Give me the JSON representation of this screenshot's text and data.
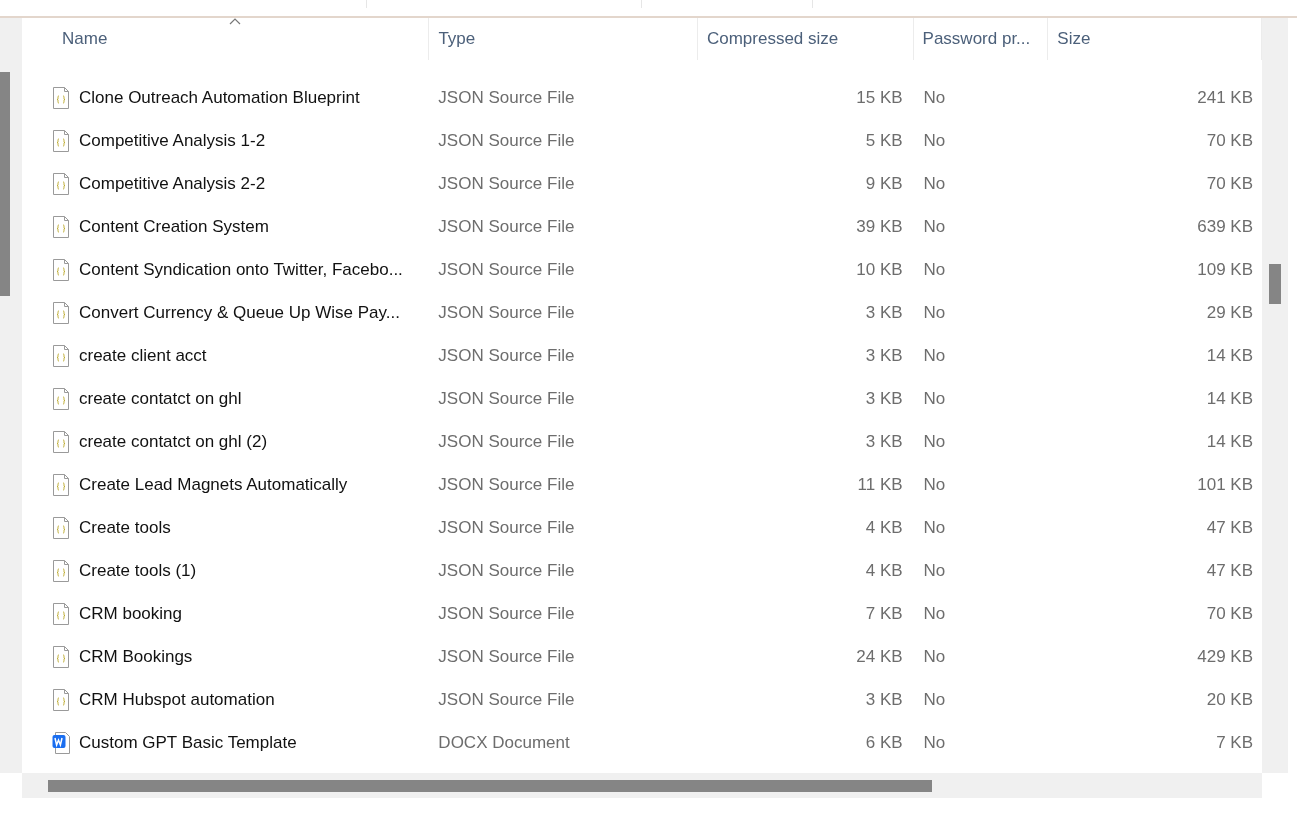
{
  "columns": [
    {
      "label": "Name",
      "sorted": true
    },
    {
      "label": "Type",
      "sorted": false
    },
    {
      "label": "Compressed size",
      "sorted": false
    },
    {
      "label": "Password pr...",
      "sorted": false
    },
    {
      "label": "Size",
      "sorted": false
    }
  ],
  "rows": [
    {
      "kind": "json",
      "name": "Clone Outreach Automation Blueprint",
      "type": "JSON Source File",
      "compressed": "15 KB",
      "password": "No",
      "size": "241 KB"
    },
    {
      "kind": "json",
      "name": "Competitive Analysis 1-2",
      "type": "JSON Source File",
      "compressed": "5 KB",
      "password": "No",
      "size": "70 KB"
    },
    {
      "kind": "json",
      "name": "Competitive Analysis 2-2",
      "type": "JSON Source File",
      "compressed": "9 KB",
      "password": "No",
      "size": "70 KB"
    },
    {
      "kind": "json",
      "name": "Content Creation System",
      "type": "JSON Source File",
      "compressed": "39 KB",
      "password": "No",
      "size": "639 KB"
    },
    {
      "kind": "json",
      "name": "Content Syndication onto Twitter, Facebo...",
      "type": "JSON Source File",
      "compressed": "10 KB",
      "password": "No",
      "size": "109 KB"
    },
    {
      "kind": "json",
      "name": "Convert Currency & Queue Up Wise Pay...",
      "type": "JSON Source File",
      "compressed": "3 KB",
      "password": "No",
      "size": "29 KB"
    },
    {
      "kind": "json",
      "name": "create client acct",
      "type": "JSON Source File",
      "compressed": "3 KB",
      "password": "No",
      "size": "14 KB"
    },
    {
      "kind": "json",
      "name": "create contatct on ghl",
      "type": "JSON Source File",
      "compressed": "3 KB",
      "password": "No",
      "size": "14 KB"
    },
    {
      "kind": "json",
      "name": "create contatct on ghl (2)",
      "type": "JSON Source File",
      "compressed": "3 KB",
      "password": "No",
      "size": "14 KB"
    },
    {
      "kind": "json",
      "name": "Create Lead Magnets Automatically",
      "type": "JSON Source File",
      "compressed": "11 KB",
      "password": "No",
      "size": "101 KB"
    },
    {
      "kind": "json",
      "name": "Create tools",
      "type": "JSON Source File",
      "compressed": "4 KB",
      "password": "No",
      "size": "47 KB"
    },
    {
      "kind": "json",
      "name": "Create tools (1)",
      "type": "JSON Source File",
      "compressed": "4 KB",
      "password": "No",
      "size": "47 KB"
    },
    {
      "kind": "json",
      "name": "CRM booking",
      "type": "JSON Source File",
      "compressed": "7 KB",
      "password": "No",
      "size": "70 KB"
    },
    {
      "kind": "json",
      "name": "CRM Bookings",
      "type": "JSON Source File",
      "compressed": "24 KB",
      "password": "No",
      "size": "429 KB"
    },
    {
      "kind": "json",
      "name": "CRM Hubspot automation",
      "type": "JSON Source File",
      "compressed": "3 KB",
      "password": "No",
      "size": "20 KB"
    },
    {
      "kind": "docx",
      "name": "Custom GPT Basic Template",
      "type": "DOCX Document",
      "compressed": "6 KB",
      "password": "No",
      "size": "7 KB"
    }
  ]
}
